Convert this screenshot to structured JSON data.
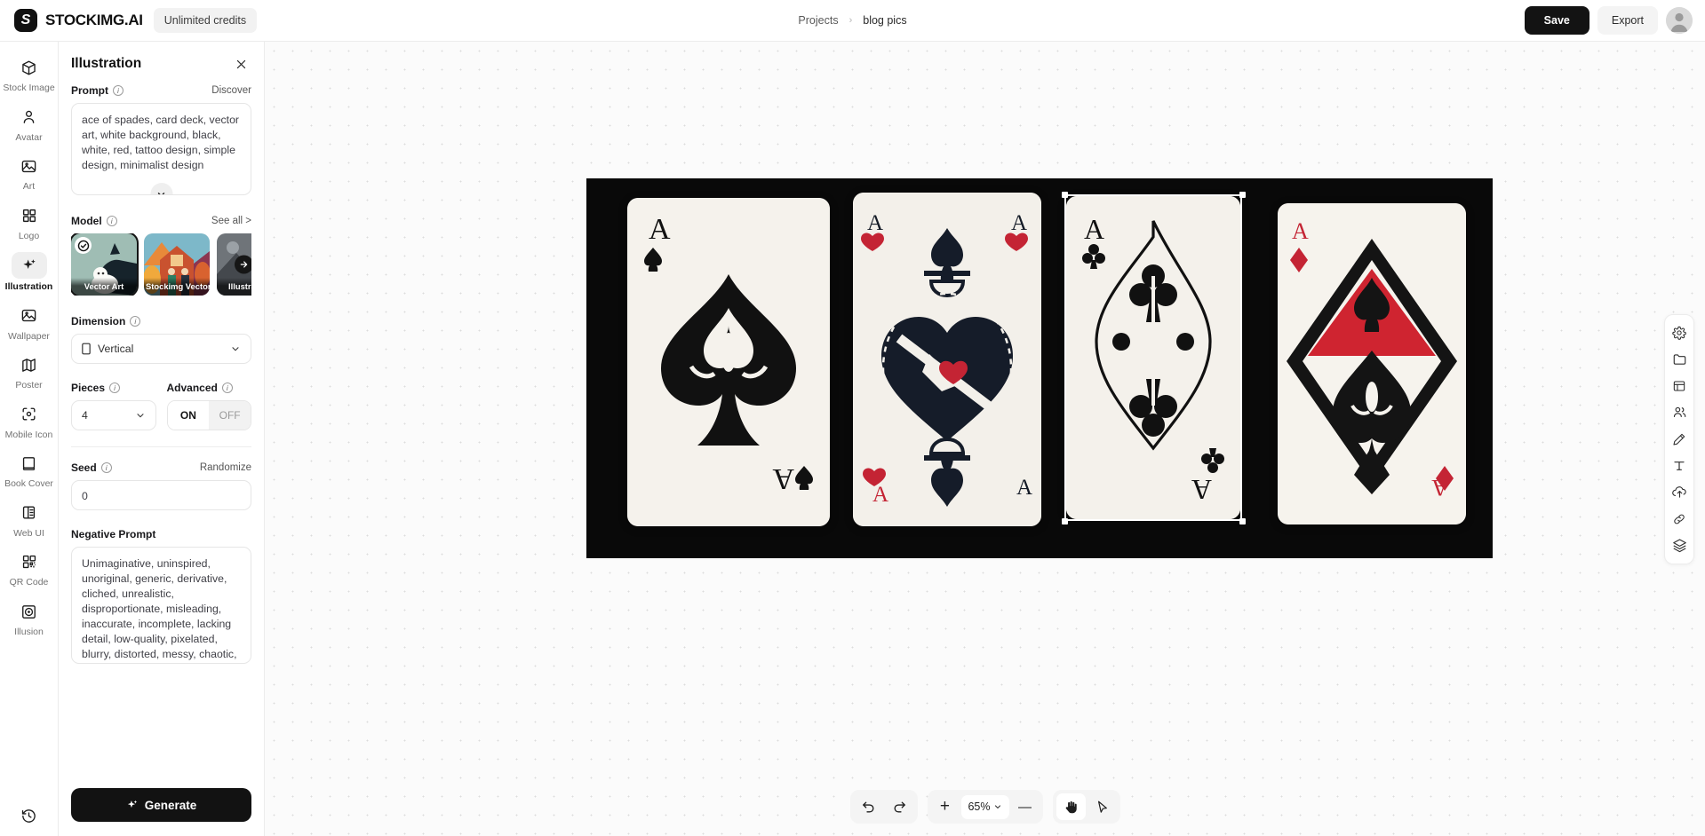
{
  "app": {
    "brand_name": "STOCKIMG.AI",
    "brand_mark": "S",
    "credits": "Unlimited credits"
  },
  "breadcrumb": {
    "root": "Projects",
    "separator": "›",
    "current": "blog pics"
  },
  "header_actions": {
    "save": "Save",
    "export": "Export",
    "avatar": "user-avatar"
  },
  "rail": {
    "items": [
      {
        "label": "Stock Image",
        "icon": "box-icon",
        "active": false
      },
      {
        "label": "Avatar",
        "icon": "person-icon",
        "active": false
      },
      {
        "label": "Art",
        "icon": "image-icon",
        "active": false
      },
      {
        "label": "Logo",
        "icon": "grid-icon",
        "active": false
      },
      {
        "label": "Illustration",
        "icon": "sparkle-icon",
        "active": true
      },
      {
        "label": "Wallpaper",
        "icon": "image-icon",
        "active": false
      },
      {
        "label": "Poster",
        "icon": "map-icon",
        "active": false
      },
      {
        "label": "Mobile Icon",
        "icon": "focus-icon",
        "active": false
      },
      {
        "label": "Book Cover",
        "icon": "book-icon",
        "active": false
      },
      {
        "label": "Web UI",
        "icon": "layout-icon",
        "active": false
      },
      {
        "label": "QR Code",
        "icon": "qr-icon",
        "active": false
      },
      {
        "label": "Illusion",
        "icon": "illusion-icon",
        "active": false
      }
    ],
    "history_icon": "history-icon"
  },
  "panel": {
    "title": "Illustration",
    "close_icon": "close-icon",
    "prompt": {
      "label": "Prompt",
      "action": "Discover",
      "value": "ace of spades, card deck, vector art, white background, black, white, red, tattoo design, simple design, minimalist design",
      "expand_icon": "chevron-down-icon"
    },
    "model": {
      "label": "Model",
      "action": "See all >",
      "next_icon": "arrow-right-icon",
      "cards": [
        {
          "name": "Vector Art",
          "selected": true,
          "c1": "#9fbdb4",
          "c2": "#13232a"
        },
        {
          "name": "Stockimg Vector",
          "selected": false,
          "c1": "#e8722c",
          "c2": "#7a2c3c"
        },
        {
          "name": "Illustration",
          "selected": false,
          "c1": "#7b7f84",
          "c2": "#3c4045"
        }
      ]
    },
    "dimension": {
      "label": "Dimension",
      "value": "Vertical",
      "icon": "portrait-icon"
    },
    "pieces": {
      "label": "Pieces",
      "value": "4"
    },
    "advanced": {
      "label": "Advanced",
      "on": "ON",
      "off": "OFF",
      "state": "ON"
    },
    "seed": {
      "label": "Seed",
      "action": "Randomize",
      "value": "0"
    },
    "negative_prompt": {
      "label": "Negative Prompt",
      "value": "Unimaginative, uninspired, unoriginal, generic, derivative, cliched, unrealistic, disproportionate, misleading, inaccurate, incomplete, lacking detail, low-quality, pixelated, blurry, distorted, messy, chaotic,"
    },
    "generate": {
      "label": "Generate",
      "icon": "sparkle-icon"
    }
  },
  "canvas": {
    "cards": [
      {
        "name": "ace-of-spades-card-1",
        "suit": "spade",
        "rank": "A",
        "color": "#111111"
      },
      {
        "name": "ace-of-spades-card-2",
        "suit": "heart-spade",
        "rank": "A",
        "color": "#1a1f2b"
      },
      {
        "name": "ace-of-spades-card-3",
        "suit": "club",
        "rank": "A",
        "color": "#111111",
        "selected": true
      },
      {
        "name": "ace-of-diamonds-card-4",
        "suit": "diamond",
        "rank": "A",
        "color": "#cf2430"
      }
    ]
  },
  "right_tools": [
    {
      "name": "settings-icon"
    },
    {
      "name": "folder-icon"
    },
    {
      "name": "table-icon"
    },
    {
      "name": "people-icon"
    },
    {
      "name": "pen-icon"
    },
    {
      "name": "text-icon"
    },
    {
      "name": "upload-icon"
    },
    {
      "name": "link-icon"
    },
    {
      "name": "layers-icon"
    }
  ],
  "bottom": {
    "undo_icon": "undo-icon",
    "redo_icon": "redo-icon",
    "zoom_in": "+",
    "zoom_out": "—",
    "zoom_level": "65%",
    "zoom_chevron": "chevron-down-icon",
    "hand_tool": "hand-icon",
    "select_tool": "cursor-icon"
  }
}
